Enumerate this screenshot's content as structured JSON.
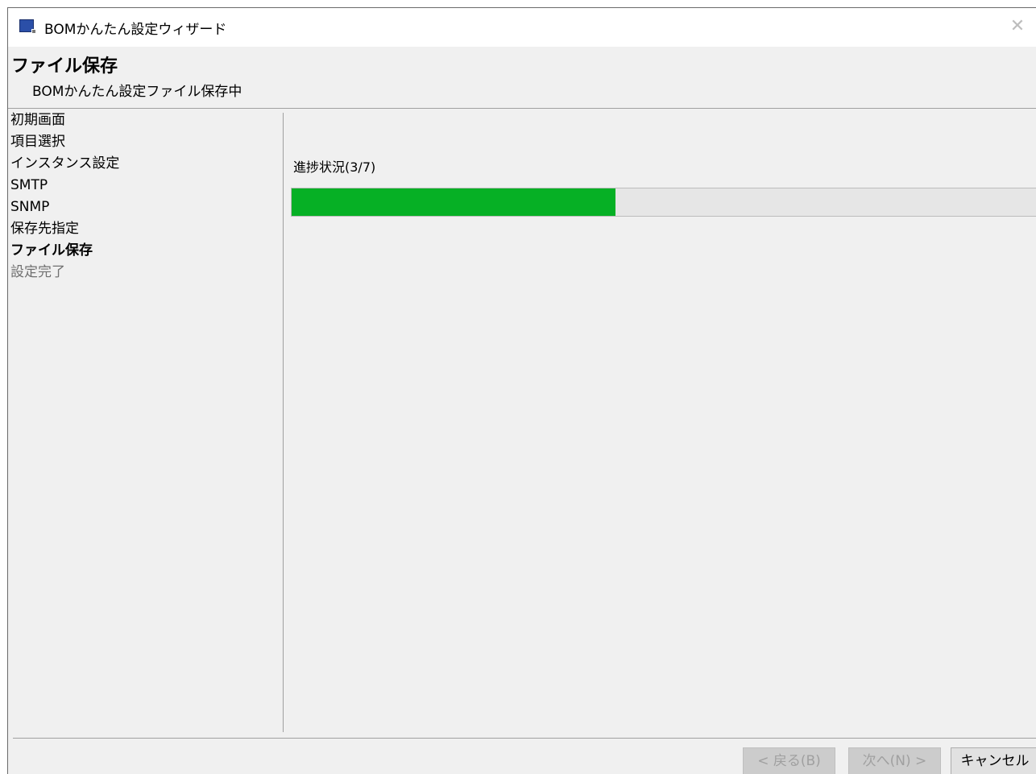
{
  "window": {
    "title": "BOMかんたん設定ウィザード",
    "app_icon": "application-icon",
    "close_icon": "close-icon",
    "close_glyph": "✕"
  },
  "header": {
    "heading": "ファイル保存",
    "subheading": "BOMかんたん設定ファイル保存中"
  },
  "steps": [
    {
      "label": "初期画面",
      "state": "done"
    },
    {
      "label": "項目選択",
      "state": "done"
    },
    {
      "label": "インスタンス設定",
      "state": "done"
    },
    {
      "label": "SMTP",
      "state": "done"
    },
    {
      "label": "SNMP",
      "state": "done"
    },
    {
      "label": "保存先指定",
      "state": "done"
    },
    {
      "label": "ファイル保存",
      "state": "current"
    },
    {
      "label": "設定完了",
      "state": "pending"
    }
  ],
  "progress": {
    "label": "進捗状況(3/7)",
    "fraction": 0.4286,
    "fill_color": "#06b025"
  },
  "buttons": {
    "back": "< 戻る(B)",
    "next": "次へ(N) >",
    "cancel": "キャンセル"
  }
}
